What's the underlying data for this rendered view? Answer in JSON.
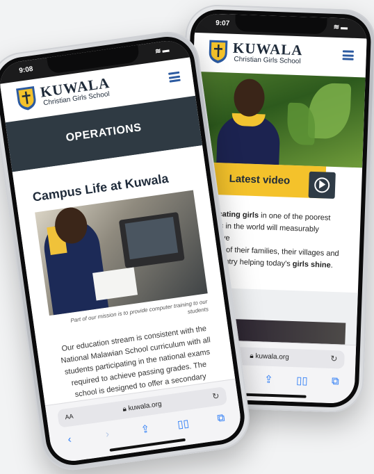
{
  "back_phone": {
    "status_time": "9:07",
    "brand_name": "KUWALA",
    "brand_sub": "Christian Girls School",
    "latest_video_label": "Latest video",
    "intro_parts": {
      "b1": "Educating girls",
      "t1": " in one of the poorest",
      "t2": "ations in the world will measurably improve",
      "t3": "e lives of their families, their villages and",
      "t4": "eir country helping today's ",
      "b2": "girls shine",
      "t5": "."
    },
    "url": "kuwala.org"
  },
  "front_phone": {
    "status_time": "9:08",
    "brand_name": "KUWALA",
    "brand_sub": "Christian Girls School",
    "section_title": "OPERATIONS",
    "article_title": "Campus Life at Kuwala",
    "photo_caption": "Part of our mission is to provide computer training to our students",
    "paragraph": "Our education stream is consistent with the National Malawian School curriculum with all students participating in the national exams required to achieve passing grades. The school is designed to offer a secondary",
    "url_prefix": "AA",
    "url": "kuwala.org"
  },
  "colors": {
    "brand_navy": "#1f2b3a",
    "accent_yellow": "#f4c22b",
    "link_blue": "#2a7bf6",
    "menu_blue": "#2c5aa0"
  },
  "icons": [
    "menu-icon",
    "play-icon",
    "lock-icon",
    "reload-icon",
    "back-icon",
    "forward-icon",
    "share-icon",
    "bookmarks-icon",
    "tabs-icon",
    "wifi-icon",
    "battery-icon",
    "school-crest-icon"
  ]
}
